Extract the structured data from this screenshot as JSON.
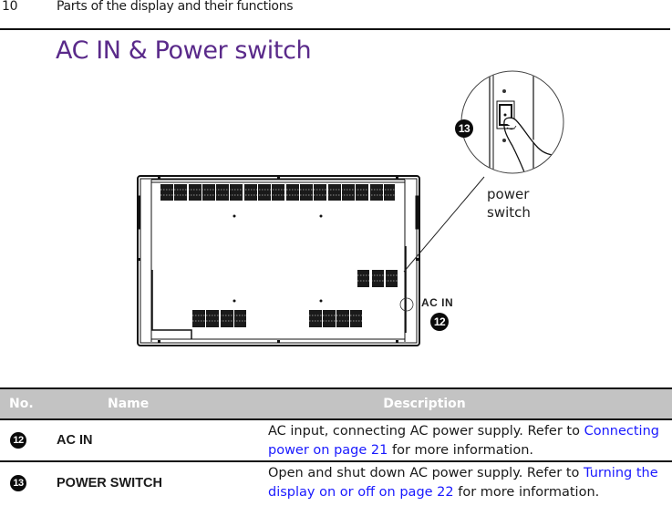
{
  "page_header": {
    "page_number": "10",
    "section": "Parts of the display and their functions"
  },
  "title": "AC IN & Power switch",
  "colors": {
    "title": "#5a2a8a",
    "link": "#1a1aff",
    "table_header_bg": "#c3c3c3",
    "badge_bg": "#0a0a0a"
  },
  "diagram": {
    "power_switch_label_line1": "power",
    "power_switch_label_line2": "switch",
    "ac_in_label": "AC IN",
    "badge_power_switch": "13",
    "badge_ac_in": "12"
  },
  "table": {
    "headers": {
      "no": "No.",
      "name": "Name",
      "description": "Description"
    },
    "rows": [
      {
        "no": "12",
        "name": "AC IN",
        "desc_text": "AC input, connecting AC power supply. Refer to ",
        "desc_link": "Connecting power on page 21",
        "desc_tail": " for more information."
      },
      {
        "no": "13",
        "name": "POWER SWITCH",
        "desc_text": "Open and shut down AC power supply. Refer to ",
        "desc_link": "Turning the display on or off on page 22",
        "desc_tail": " for more information."
      }
    ]
  }
}
